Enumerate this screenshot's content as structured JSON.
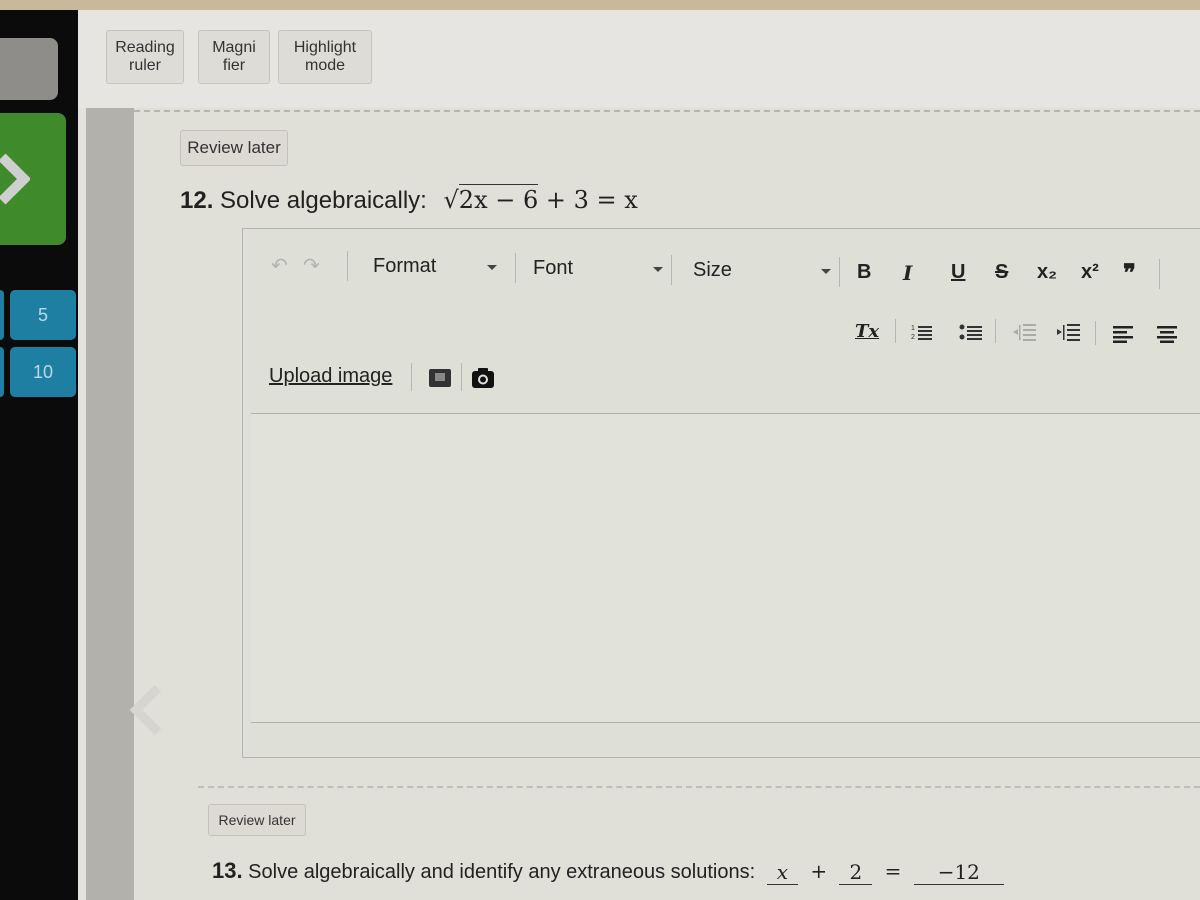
{
  "tools": {
    "reading_ruler": "Reading ruler",
    "reading_ruler_l1": "Reading",
    "reading_ruler_l2": "ruler",
    "magnifier_l1": "Magni",
    "magnifier_l2": "fier",
    "highlight_l1": "Highlight",
    "highlight_l2": "mode"
  },
  "nav": {
    "next_label": "Next",
    "question_tiles": [
      "5",
      "10"
    ],
    "colors": {
      "next": "#3f8a2a",
      "tile": "#1e7fa3",
      "panel": "#0b0b0b"
    }
  },
  "question12": {
    "review_label": "Review later",
    "number": "12.",
    "prompt": "Solve algebraically:",
    "equation": {
      "radicand": "2x − 6",
      "rest": "+ 3 = x",
      "sqrt_symbol": "√"
    }
  },
  "editor": {
    "undo_icon": "undo-icon",
    "redo_icon": "redo-icon",
    "format_label": "Format",
    "font_label": "Font",
    "size_label": "Size",
    "bold": "B",
    "italic": "I",
    "underline": "U",
    "strike": "S",
    "subscript": "x₂",
    "superscript": "x²",
    "blockquote": "❞",
    "remove_format": "Tx",
    "upload_image": "Upload image",
    "body_text": ""
  },
  "question13": {
    "review_label": "Review later",
    "number": "13.",
    "prompt": "Solve algebraically and identify any extraneous solutions:",
    "equation": {
      "frac1_num": "x",
      "plus": "+",
      "frac2_num": "2",
      "equals": "=",
      "frac3_num": "−12"
    }
  }
}
